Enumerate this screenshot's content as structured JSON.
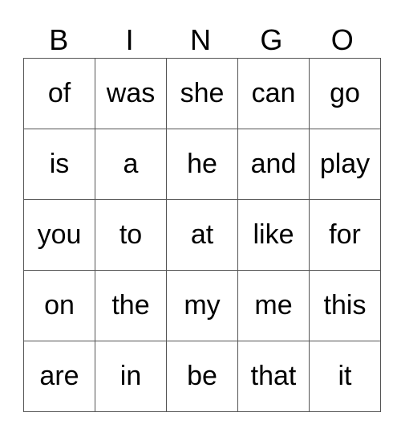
{
  "header": [
    "B",
    "I",
    "N",
    "G",
    "O"
  ],
  "rows": [
    [
      "of",
      "was",
      "she",
      "can",
      "go"
    ],
    [
      "is",
      "a",
      "he",
      "and",
      "play"
    ],
    [
      "you",
      "to",
      "at",
      "like",
      "for"
    ],
    [
      "on",
      "the",
      "my",
      "me",
      "this"
    ],
    [
      "are",
      "in",
      "be",
      "that",
      "it"
    ]
  ]
}
